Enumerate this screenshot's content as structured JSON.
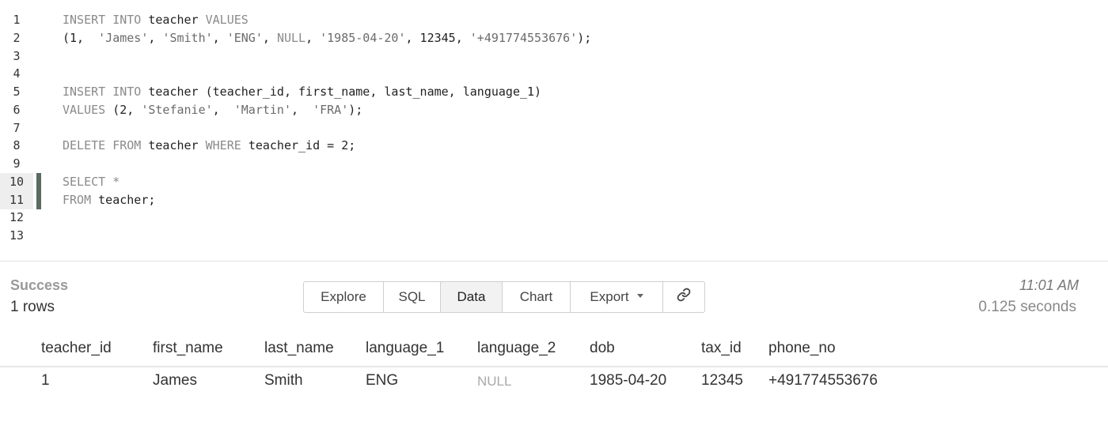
{
  "editor": {
    "lines": [
      {
        "num": "1",
        "tokens": [
          [
            "kw",
            "INSERT INTO "
          ],
          [
            "id",
            "teacher "
          ],
          [
            "kw",
            "VALUES"
          ]
        ]
      },
      {
        "num": "2",
        "tokens": [
          [
            "id",
            "(1,  "
          ],
          [
            "str",
            "'James'"
          ],
          [
            "id",
            ", "
          ],
          [
            "str",
            "'Smith'"
          ],
          [
            "id",
            ", "
          ],
          [
            "str",
            "'ENG'"
          ],
          [
            "id",
            ", "
          ],
          [
            "kw",
            "NULL"
          ],
          [
            "id",
            ", "
          ],
          [
            "str",
            "'1985-04-20'"
          ],
          [
            "id",
            ", 12345, "
          ],
          [
            "str",
            "'+491774553676'"
          ],
          [
            "id",
            ");"
          ]
        ]
      },
      {
        "num": "3",
        "tokens": []
      },
      {
        "num": "4",
        "tokens": []
      },
      {
        "num": "5",
        "tokens": [
          [
            "kw",
            "INSERT INTO "
          ],
          [
            "id",
            "teacher (teacher_id, first_name, last_name, language_1)"
          ]
        ]
      },
      {
        "num": "6",
        "tokens": [
          [
            "kw",
            "VALUES "
          ],
          [
            "id",
            "(2, "
          ],
          [
            "str",
            "'Stefanie'"
          ],
          [
            "id",
            ",  "
          ],
          [
            "str",
            "'Martin'"
          ],
          [
            "id",
            ",  "
          ],
          [
            "str",
            "'FRA'"
          ],
          [
            "id",
            ");"
          ]
        ]
      },
      {
        "num": "7",
        "tokens": []
      },
      {
        "num": "8",
        "tokens": [
          [
            "kw",
            "DELETE FROM "
          ],
          [
            "id",
            "teacher "
          ],
          [
            "kw",
            "WHERE "
          ],
          [
            "id",
            "teacher_id = 2;"
          ]
        ]
      },
      {
        "num": "9",
        "tokens": []
      },
      {
        "num": "10",
        "tokens": [
          [
            "kw",
            "SELECT *"
          ]
        ],
        "active": true
      },
      {
        "num": "11",
        "tokens": [
          [
            "kw",
            "FROM "
          ],
          [
            "id",
            "teacher;"
          ]
        ],
        "active": true
      },
      {
        "num": "12",
        "tokens": []
      },
      {
        "num": "13",
        "tokens": []
      }
    ]
  },
  "result": {
    "status": "Success",
    "row_count": "1 rows",
    "time": "11:01 AM",
    "duration": "0.125 seconds",
    "toolbar": {
      "explore": "Explore",
      "sql": "SQL",
      "data": "Data",
      "chart": "Chart",
      "export": "Export",
      "link_icon": "link-icon"
    },
    "columns": [
      "teacher_id",
      "first_name",
      "last_name",
      "language_1",
      "language_2",
      "dob",
      "tax_id",
      "phone_no"
    ],
    "rows": [
      [
        "1",
        "James",
        "Smith",
        "ENG",
        "NULL",
        "1985-04-20",
        "12345",
        "+491774553676"
      ]
    ]
  }
}
